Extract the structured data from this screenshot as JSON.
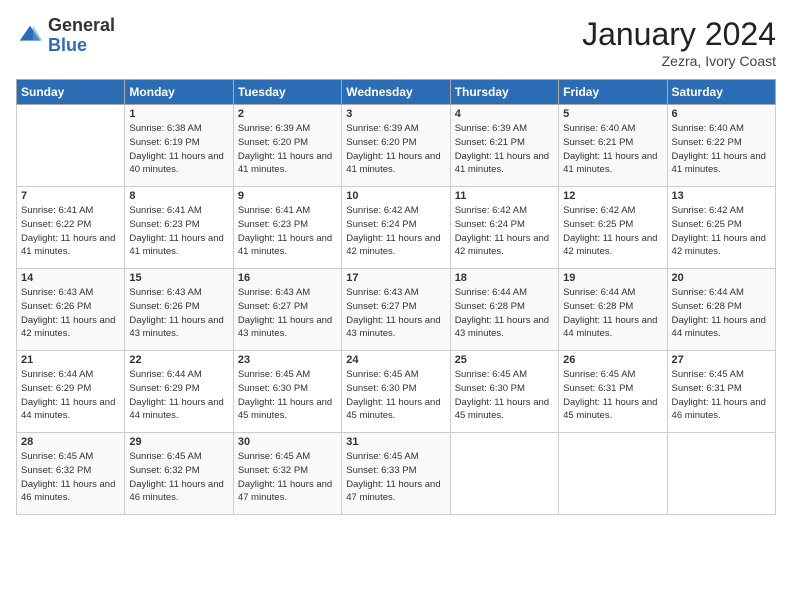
{
  "header": {
    "logo_general": "General",
    "logo_blue": "Blue",
    "title": "January 2024",
    "location": "Zezra, Ivory Coast"
  },
  "columns": [
    "Sunday",
    "Monday",
    "Tuesday",
    "Wednesday",
    "Thursday",
    "Friday",
    "Saturday"
  ],
  "weeks": [
    [
      {
        "day": "",
        "sunrise": "",
        "sunset": "",
        "daylight": ""
      },
      {
        "day": "1",
        "sunrise": "Sunrise: 6:38 AM",
        "sunset": "Sunset: 6:19 PM",
        "daylight": "Daylight: 11 hours and 40 minutes."
      },
      {
        "day": "2",
        "sunrise": "Sunrise: 6:39 AM",
        "sunset": "Sunset: 6:20 PM",
        "daylight": "Daylight: 11 hours and 41 minutes."
      },
      {
        "day": "3",
        "sunrise": "Sunrise: 6:39 AM",
        "sunset": "Sunset: 6:20 PM",
        "daylight": "Daylight: 11 hours and 41 minutes."
      },
      {
        "day": "4",
        "sunrise": "Sunrise: 6:39 AM",
        "sunset": "Sunset: 6:21 PM",
        "daylight": "Daylight: 11 hours and 41 minutes."
      },
      {
        "day": "5",
        "sunrise": "Sunrise: 6:40 AM",
        "sunset": "Sunset: 6:21 PM",
        "daylight": "Daylight: 11 hours and 41 minutes."
      },
      {
        "day": "6",
        "sunrise": "Sunrise: 6:40 AM",
        "sunset": "Sunset: 6:22 PM",
        "daylight": "Daylight: 11 hours and 41 minutes."
      }
    ],
    [
      {
        "day": "7",
        "sunrise": "Sunrise: 6:41 AM",
        "sunset": "Sunset: 6:22 PM",
        "daylight": "Daylight: 11 hours and 41 minutes."
      },
      {
        "day": "8",
        "sunrise": "Sunrise: 6:41 AM",
        "sunset": "Sunset: 6:23 PM",
        "daylight": "Daylight: 11 hours and 41 minutes."
      },
      {
        "day": "9",
        "sunrise": "Sunrise: 6:41 AM",
        "sunset": "Sunset: 6:23 PM",
        "daylight": "Daylight: 11 hours and 41 minutes."
      },
      {
        "day": "10",
        "sunrise": "Sunrise: 6:42 AM",
        "sunset": "Sunset: 6:24 PM",
        "daylight": "Daylight: 11 hours and 42 minutes."
      },
      {
        "day": "11",
        "sunrise": "Sunrise: 6:42 AM",
        "sunset": "Sunset: 6:24 PM",
        "daylight": "Daylight: 11 hours and 42 minutes."
      },
      {
        "day": "12",
        "sunrise": "Sunrise: 6:42 AM",
        "sunset": "Sunset: 6:25 PM",
        "daylight": "Daylight: 11 hours and 42 minutes."
      },
      {
        "day": "13",
        "sunrise": "Sunrise: 6:42 AM",
        "sunset": "Sunset: 6:25 PM",
        "daylight": "Daylight: 11 hours and 42 minutes."
      }
    ],
    [
      {
        "day": "14",
        "sunrise": "Sunrise: 6:43 AM",
        "sunset": "Sunset: 6:26 PM",
        "daylight": "Daylight: 11 hours and 42 minutes."
      },
      {
        "day": "15",
        "sunrise": "Sunrise: 6:43 AM",
        "sunset": "Sunset: 6:26 PM",
        "daylight": "Daylight: 11 hours and 43 minutes."
      },
      {
        "day": "16",
        "sunrise": "Sunrise: 6:43 AM",
        "sunset": "Sunset: 6:27 PM",
        "daylight": "Daylight: 11 hours and 43 minutes."
      },
      {
        "day": "17",
        "sunrise": "Sunrise: 6:43 AM",
        "sunset": "Sunset: 6:27 PM",
        "daylight": "Daylight: 11 hours and 43 minutes."
      },
      {
        "day": "18",
        "sunrise": "Sunrise: 6:44 AM",
        "sunset": "Sunset: 6:28 PM",
        "daylight": "Daylight: 11 hours and 43 minutes."
      },
      {
        "day": "19",
        "sunrise": "Sunrise: 6:44 AM",
        "sunset": "Sunset: 6:28 PM",
        "daylight": "Daylight: 11 hours and 44 minutes."
      },
      {
        "day": "20",
        "sunrise": "Sunrise: 6:44 AM",
        "sunset": "Sunset: 6:28 PM",
        "daylight": "Daylight: 11 hours and 44 minutes."
      }
    ],
    [
      {
        "day": "21",
        "sunrise": "Sunrise: 6:44 AM",
        "sunset": "Sunset: 6:29 PM",
        "daylight": "Daylight: 11 hours and 44 minutes."
      },
      {
        "day": "22",
        "sunrise": "Sunrise: 6:44 AM",
        "sunset": "Sunset: 6:29 PM",
        "daylight": "Daylight: 11 hours and 44 minutes."
      },
      {
        "day": "23",
        "sunrise": "Sunrise: 6:45 AM",
        "sunset": "Sunset: 6:30 PM",
        "daylight": "Daylight: 11 hours and 45 minutes."
      },
      {
        "day": "24",
        "sunrise": "Sunrise: 6:45 AM",
        "sunset": "Sunset: 6:30 PM",
        "daylight": "Daylight: 11 hours and 45 minutes."
      },
      {
        "day": "25",
        "sunrise": "Sunrise: 6:45 AM",
        "sunset": "Sunset: 6:30 PM",
        "daylight": "Daylight: 11 hours and 45 minutes."
      },
      {
        "day": "26",
        "sunrise": "Sunrise: 6:45 AM",
        "sunset": "Sunset: 6:31 PM",
        "daylight": "Daylight: 11 hours and 45 minutes."
      },
      {
        "day": "27",
        "sunrise": "Sunrise: 6:45 AM",
        "sunset": "Sunset: 6:31 PM",
        "daylight": "Daylight: 11 hours and 46 minutes."
      }
    ],
    [
      {
        "day": "28",
        "sunrise": "Sunrise: 6:45 AM",
        "sunset": "Sunset: 6:32 PM",
        "daylight": "Daylight: 11 hours and 46 minutes."
      },
      {
        "day": "29",
        "sunrise": "Sunrise: 6:45 AM",
        "sunset": "Sunset: 6:32 PM",
        "daylight": "Daylight: 11 hours and 46 minutes."
      },
      {
        "day": "30",
        "sunrise": "Sunrise: 6:45 AM",
        "sunset": "Sunset: 6:32 PM",
        "daylight": "Daylight: 11 hours and 47 minutes."
      },
      {
        "day": "31",
        "sunrise": "Sunrise: 6:45 AM",
        "sunset": "Sunset: 6:33 PM",
        "daylight": "Daylight: 11 hours and 47 minutes."
      },
      {
        "day": "",
        "sunrise": "",
        "sunset": "",
        "daylight": ""
      },
      {
        "day": "",
        "sunrise": "",
        "sunset": "",
        "daylight": ""
      },
      {
        "day": "",
        "sunrise": "",
        "sunset": "",
        "daylight": ""
      }
    ]
  ]
}
